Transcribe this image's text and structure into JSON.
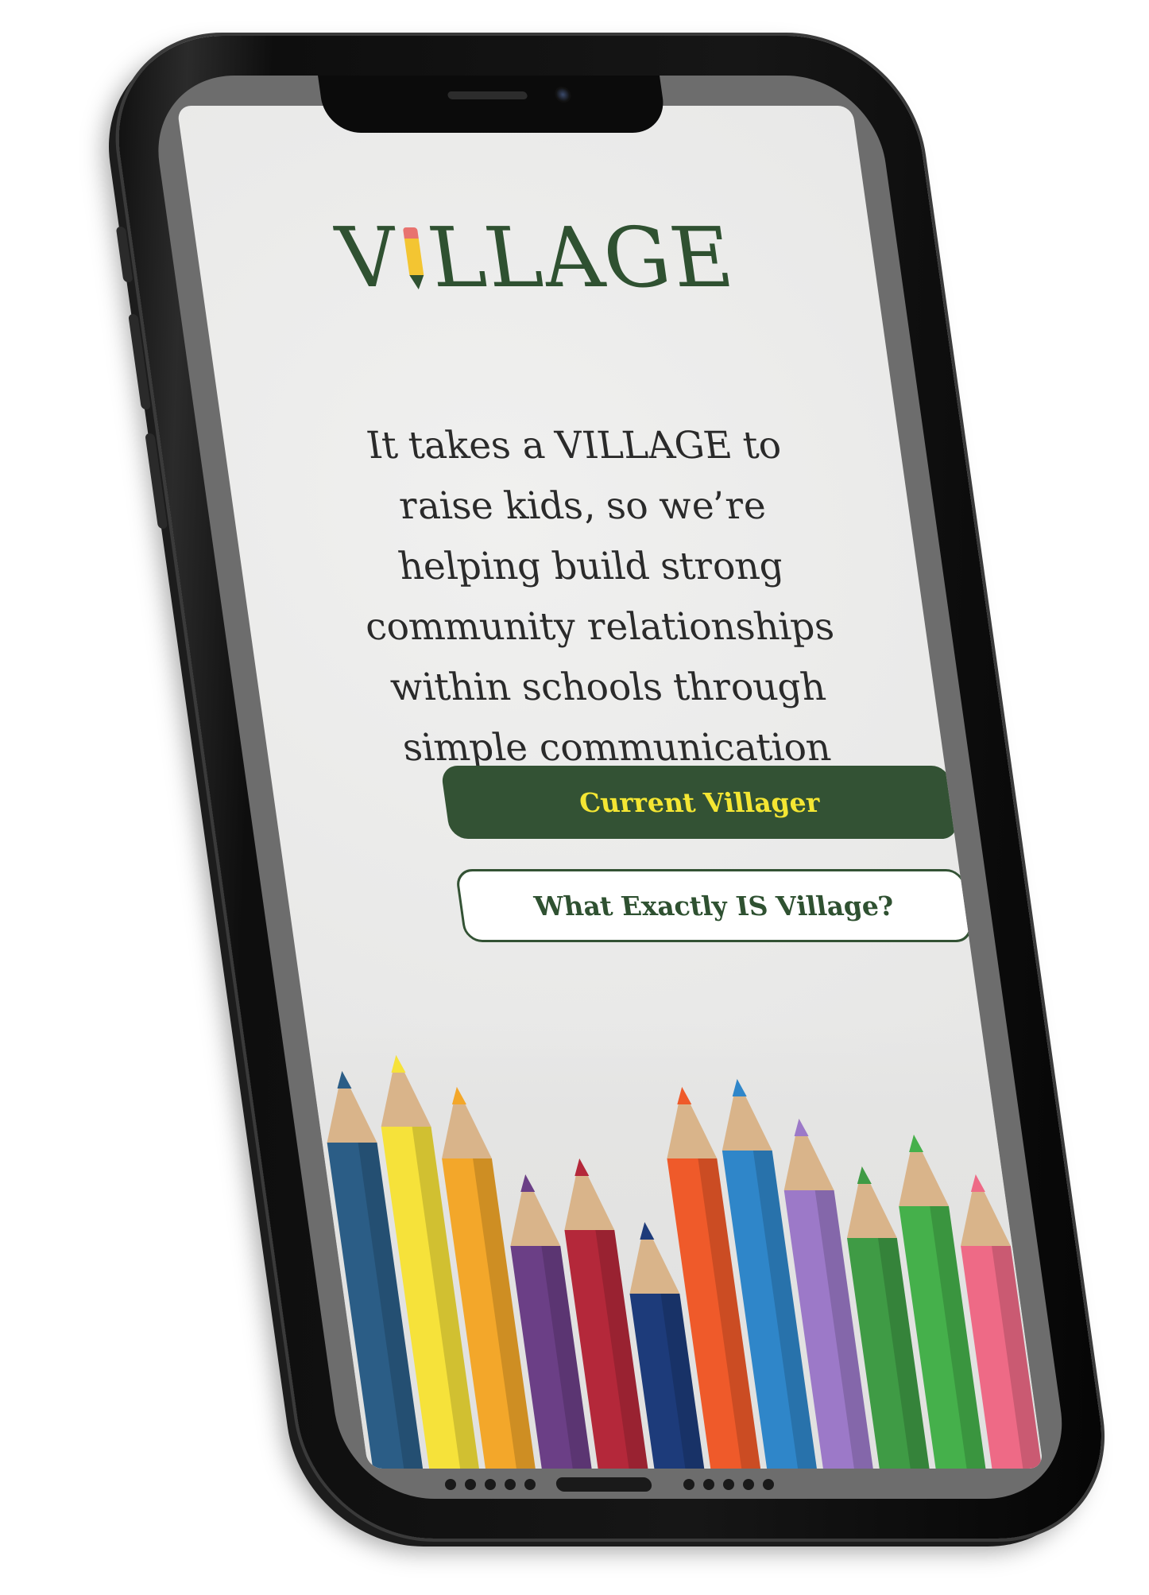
{
  "app": {
    "logo_text_prefix": "V",
    "logo_text_suffix": "LLAGE"
  },
  "hero": {
    "tagline_lines": [
      "It takes a VILLAGE to",
      "raise kids, so we’re",
      "helping build strong",
      "community relationships",
      "within schools through",
      "simple communication"
    ]
  },
  "actions": {
    "primary_label": "Current Villager",
    "secondary_label": "What Exactly IS Village?"
  },
  "colors": {
    "brand_green": "#335234",
    "accent_yellow": "#f4e633",
    "text_dark": "#2a2a2a"
  },
  "decor": {
    "image": "colored-pencils",
    "pencil_colors": [
      "#2b5d86",
      "#f6e23a",
      "#f3a72a",
      "#6b3f86",
      "#b4283a",
      "#1d3b7a",
      "#ef5a2a",
      "#2f86c9",
      "#9c79c8",
      "#3f9b45",
      "#45b04b",
      "#ee6a86"
    ]
  }
}
